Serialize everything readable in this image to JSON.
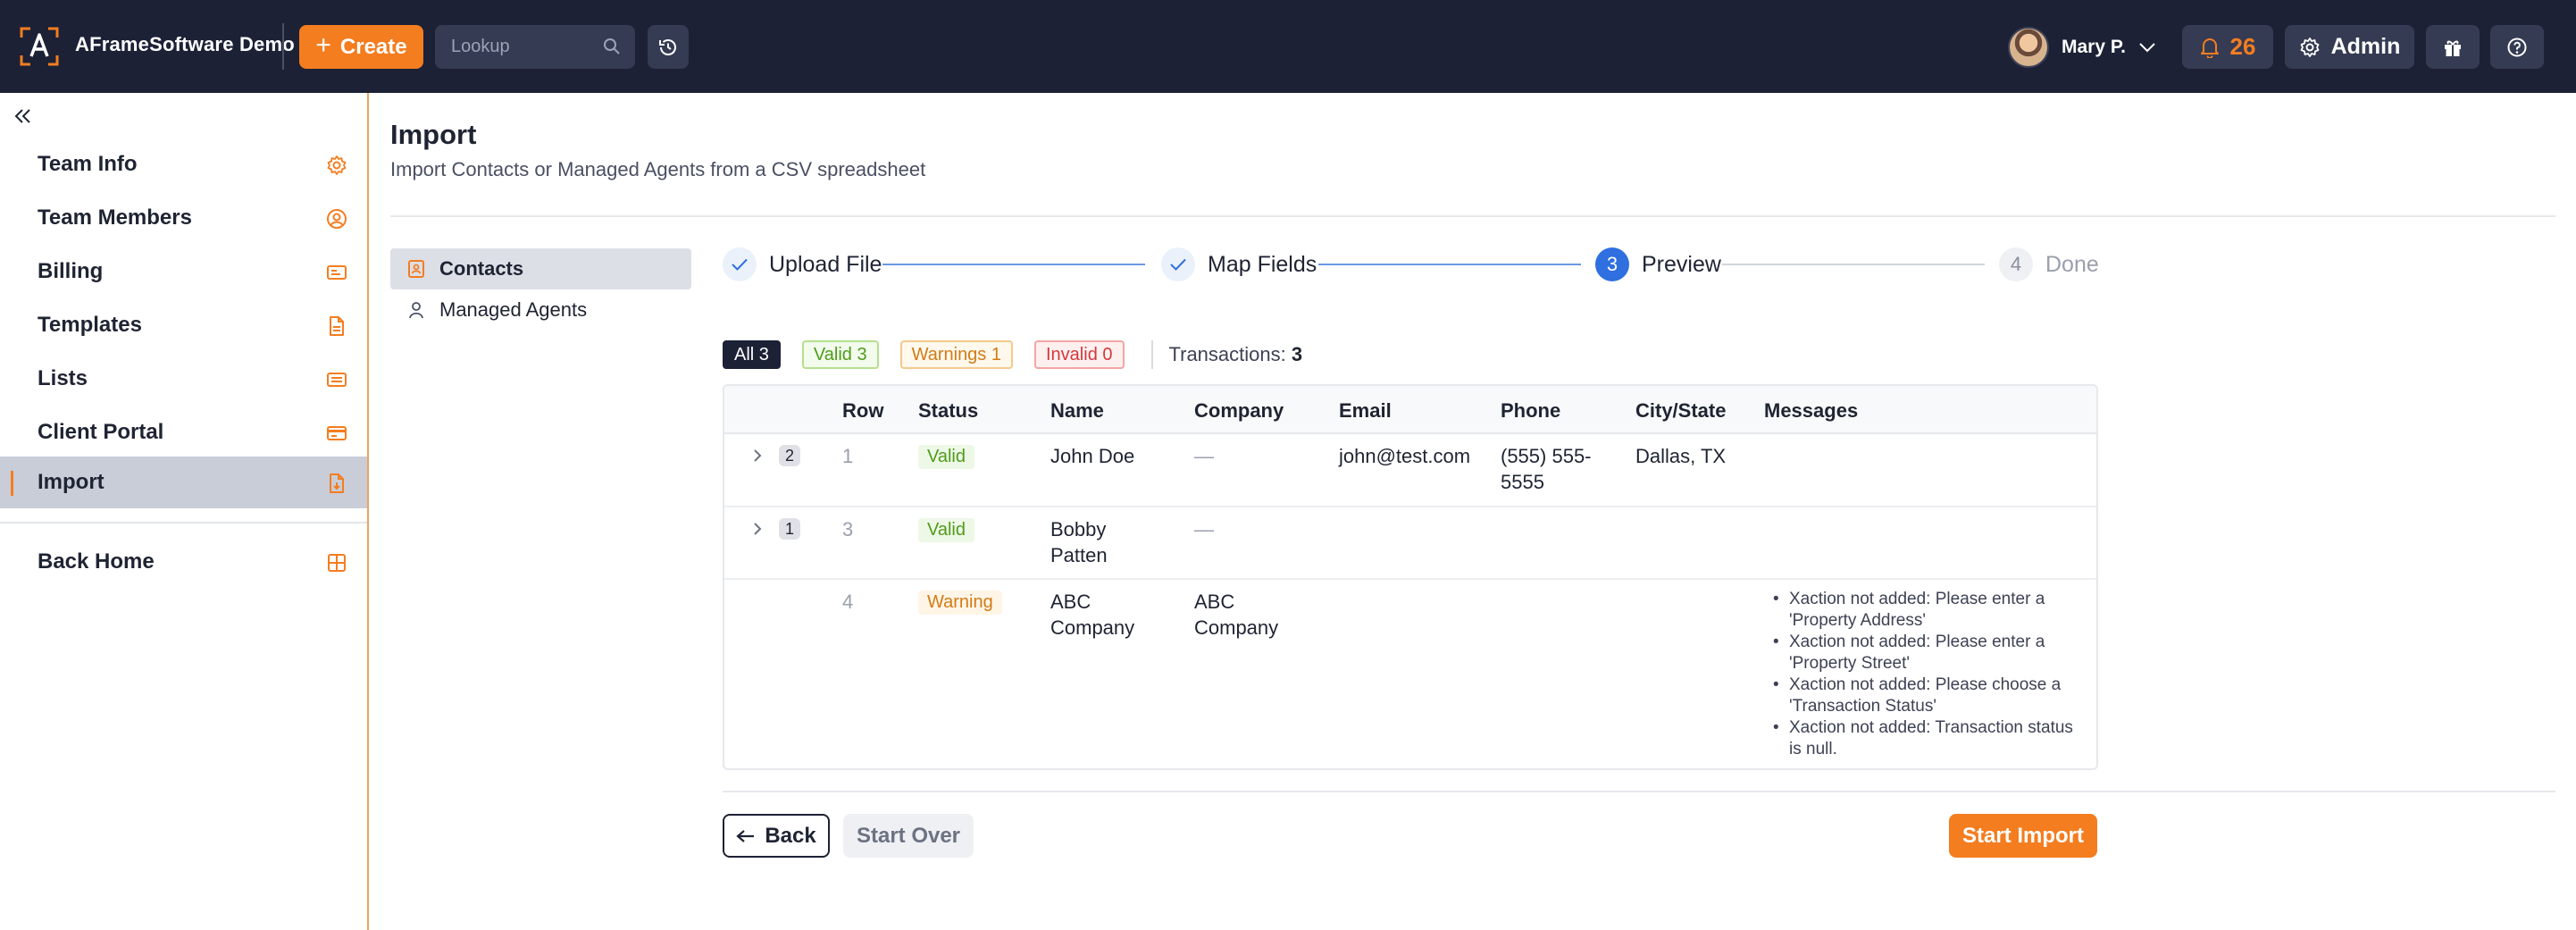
{
  "header": {
    "brand": "AFrameSoftware Demo",
    "create_label": "Create",
    "lookup_placeholder": "Lookup",
    "user_name": "Mary P.",
    "notification_count": "26",
    "admin_label": "Admin",
    "accent_color": "#f47d20",
    "bar_color": "#1c2136"
  },
  "sidebar": {
    "items": [
      {
        "label": "Team Info",
        "icon": "gear-icon"
      },
      {
        "label": "Team Members",
        "icon": "user-circle-icon"
      },
      {
        "label": "Billing",
        "icon": "card-icon"
      },
      {
        "label": "Templates",
        "icon": "document-icon"
      },
      {
        "label": "Lists",
        "icon": "list-icon"
      },
      {
        "label": "Client Portal",
        "icon": "portal-icon"
      },
      {
        "label": "Import",
        "icon": "import-icon",
        "active": true
      }
    ],
    "back_home": {
      "label": "Back Home",
      "icon": "grid-icon"
    }
  },
  "page": {
    "title": "Import",
    "subtitle": "Import Contacts or Managed Agents from a CSV spreadsheet"
  },
  "subnav": [
    {
      "label": "Contacts",
      "active": true
    },
    {
      "label": "Managed Agents",
      "active": false
    }
  ],
  "stepper": [
    {
      "label": "Upload File",
      "state": "done",
      "number": "1"
    },
    {
      "label": "Map Fields",
      "state": "done",
      "number": "2"
    },
    {
      "label": "Preview",
      "state": "current",
      "number": "3"
    },
    {
      "label": "Done",
      "state": "todo",
      "number": "4"
    }
  ],
  "filters": {
    "all": "All 3",
    "valid": "Valid 3",
    "warnings": "Warnings 1",
    "invalid": "Invalid 0",
    "transactions_label": "Transactions:",
    "transactions_count": "3"
  },
  "table": {
    "columns": [
      "Row",
      "Status",
      "Name",
      "Company",
      "Email",
      "Phone",
      "City/State",
      "Messages"
    ],
    "rows": [
      {
        "count": "2",
        "row": "1",
        "status": "Valid",
        "name": "John Doe",
        "company": "—",
        "email": "john@test.com",
        "phone": "(555) 555-5555",
        "city_state": "Dallas, TX",
        "messages": []
      },
      {
        "count": "1",
        "row": "3",
        "status": "Valid",
        "name": "Bobby Patten",
        "company": "—",
        "email": "",
        "phone": "",
        "city_state": "",
        "messages": []
      },
      {
        "count": "",
        "row": "4",
        "status": "Warning",
        "name": "ABC Company",
        "company": "ABC Company",
        "email": "",
        "phone": "",
        "city_state": "",
        "messages": [
          "Xaction not added: Please enter a 'Property Address'",
          "Xaction not added: Please enter a 'Property Street'",
          "Xaction not added: Please choose a 'Transaction Status'",
          "Xaction not added: Transaction status is null."
        ]
      }
    ]
  },
  "actions": {
    "back": "Back",
    "start_over": "Start Over",
    "start_import": "Start Import"
  }
}
